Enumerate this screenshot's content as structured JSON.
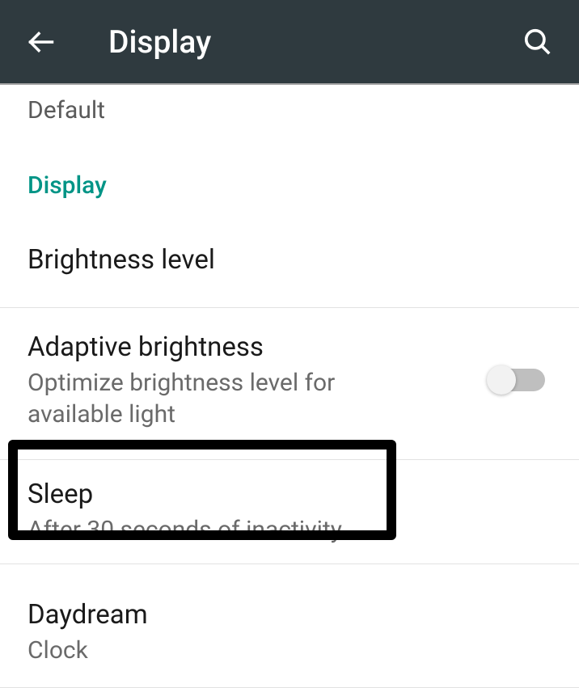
{
  "header": {
    "title": "Display"
  },
  "defaultLabel": "Default",
  "sections": {
    "display": {
      "header": "Display",
      "items": {
        "brightness": {
          "title": "Brightness level"
        },
        "adaptive": {
          "title": "Adaptive brightness",
          "subtitle": "Optimize brightness level for available light"
        },
        "sleep": {
          "title": "Sleep",
          "subtitle": "After 30 seconds of inactivity"
        },
        "daydream": {
          "title": "Daydream",
          "subtitle": "Clock"
        }
      }
    }
  }
}
